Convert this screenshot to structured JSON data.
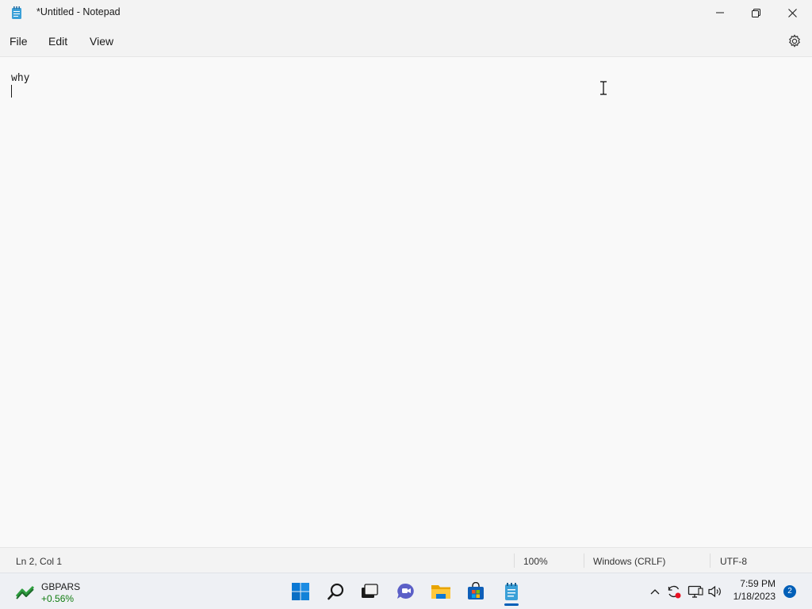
{
  "window": {
    "title": "*Untitled - Notepad",
    "buttons": {
      "minimize": "minimize",
      "maximize": "restore",
      "close": "close"
    }
  },
  "menu": {
    "file": "File",
    "edit": "Edit",
    "view": "View"
  },
  "editor": {
    "content": "why"
  },
  "status": {
    "position": "Ln 2, Col 1",
    "zoom": "100%",
    "line_ending": "Windows (CRLF)",
    "encoding": "UTF-8"
  },
  "taskbar": {
    "widget": {
      "name": "GBPARS",
      "change": "+0.56%"
    },
    "apps": [
      "start-icon",
      "search-icon",
      "task-view-icon",
      "chat-icon",
      "file-explorer-icon",
      "store-icon",
      "notepad-icon"
    ],
    "clock": {
      "time": "7:59 PM",
      "date": "1/18/2023"
    },
    "notifications": "2"
  },
  "colors": {
    "accent": "#005fb8",
    "positive": "#107c10"
  }
}
